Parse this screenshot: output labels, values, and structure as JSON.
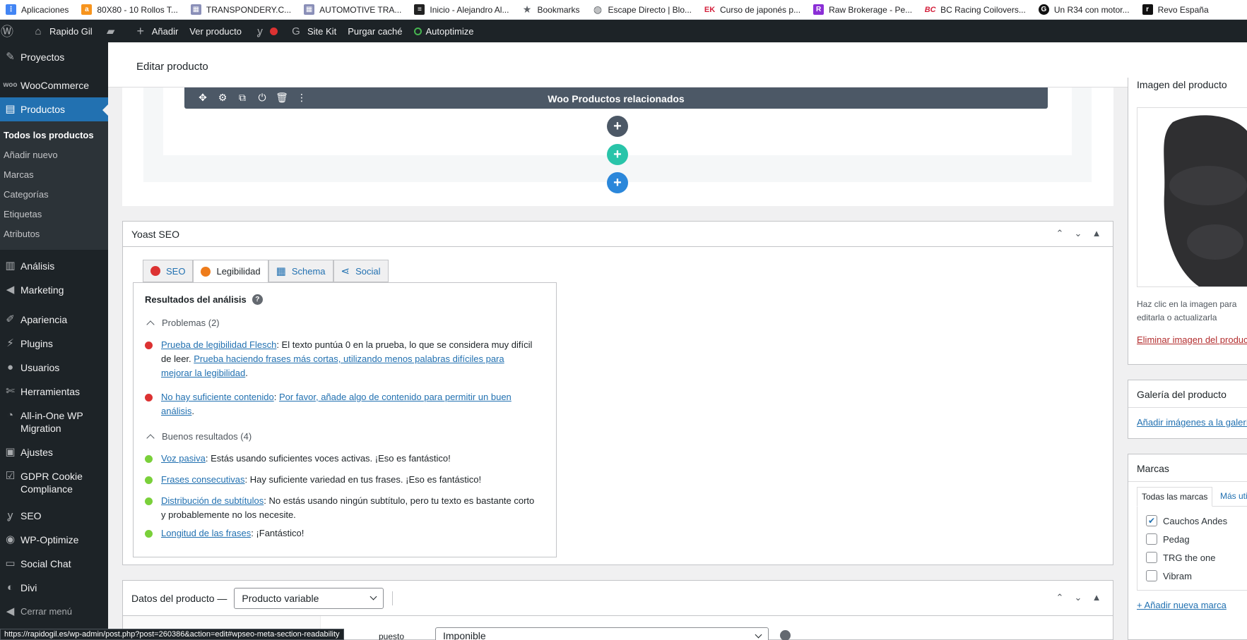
{
  "bookmarks": [
    {
      "label": "Aplicaciones",
      "icon": "apps-grid-icon",
      "color": "#4285f4"
    },
    {
      "label": "80X80 - 10 Rollos T...",
      "icon": "shop-icon",
      "color": "#f7941d"
    },
    {
      "label": "TRANSPONDERY.C...",
      "icon": "grid-icon",
      "color": "#8a8fb8"
    },
    {
      "label": "AUTOMOTIVE TRA...",
      "icon": "grid-icon",
      "color": "#8a8fb8"
    },
    {
      "label": "Inicio - Alejandro Al...",
      "icon": "stripes-icon",
      "color": "#222222"
    },
    {
      "label": "Bookmarks",
      "icon": "star-icon",
      "color": "#5f6368"
    },
    {
      "label": "Escape Directo | Blo...",
      "icon": "globe-icon",
      "color": "#5f6368"
    },
    {
      "label": "Curso de japonés p...",
      "icon": "ek-icon",
      "color": "#d4213d"
    },
    {
      "label": "Raw Brokerage - Pe...",
      "icon": "raw-icon",
      "color": "#8b2fd6"
    },
    {
      "label": "BC Racing Coilovers...",
      "icon": "bc-icon",
      "color": "#d4213d"
    },
    {
      "label": "Un R34 con motor...",
      "icon": "g-icon",
      "color": "#111111"
    },
    {
      "label": "Revo España",
      "icon": "revo-icon",
      "color": "#111111"
    }
  ],
  "adminbar": {
    "site": "Rapido Gil",
    "add": "Añadir",
    "view": "Ver producto",
    "sitekit": "Site Kit",
    "purge": "Purgar caché",
    "autoptimize": "Autoptimize"
  },
  "sidebar": {
    "items_top": [
      "Proyectos",
      "WooCommerce",
      "Productos"
    ],
    "submenu": [
      "Todos los productos",
      "Añadir nuevo",
      "Marcas",
      "Categorías",
      "Etiquetas",
      "Atributos"
    ],
    "items_bottom": [
      "Análisis",
      "Marketing",
      "Apariencia",
      "Plugins",
      "Usuarios",
      "Herramientas",
      "All-in-One WP Migration",
      "Ajustes",
      "GDPR Cookie Compliance",
      "SEO",
      "WP-Optimize",
      "Social Chat",
      "Divi",
      "Cerrar menú"
    ]
  },
  "header": {
    "title": "Editar producto"
  },
  "divi": {
    "module_title": "Woo Productos relacionados"
  },
  "yoast": {
    "title": "Yoast SEO",
    "tabs": [
      "SEO",
      "Legibilidad",
      "Schema",
      "Social"
    ],
    "analysis_title": "Resultados del análisis",
    "problems_head": "Problemas (2)",
    "problems": [
      {
        "link": "Prueba de legibilidad Flesch",
        "text": ": El texto puntúa 0 en la prueba, lo que se considera muy difícil de leer. ",
        "link2": "Prueba haciendo frases más cortas, utilizando menos palabras difíciles para mejorar la legibilidad",
        "end": "."
      },
      {
        "link": "No hay suficiente contenido",
        "text": ": ",
        "link2": "Por favor, añade algo de contenido para permitir un buen análisis",
        "end": "."
      }
    ],
    "good_head": "Buenos resultados (4)",
    "good": [
      {
        "link": "Voz pasiva",
        "text": ": Estás usando suficientes voces activas. ¡Eso es fantástico!"
      },
      {
        "link": "Frases consecutivas",
        "text": ": Hay suficiente variedad en tus frases. ¡Eso es fantástico!"
      },
      {
        "link": "Distribución de subtítulos",
        "text": ": No estás usando ningún subtítulo, pero tu texto es bastante corto y probablemente no los necesite."
      },
      {
        "link": "Longitud de las frases",
        "text": ": ¡Fantástico!"
      }
    ]
  },
  "product_data": {
    "label": "Datos del producto —",
    "type": "Producto variable",
    "tax_label": "puesto",
    "tax_value": "Imponible"
  },
  "right": {
    "image_title": "Imagen del producto",
    "image_hint": "Haz clic en la imagen para editarla o actualizarla",
    "remove_image": "Eliminar imagen del producto",
    "gallery_title": "Galería del producto",
    "gallery_link": "Añadir imágenes a la galería",
    "brands_title": "Marcas",
    "brand_tabs": [
      "Todas las marcas",
      "Más utilizadas"
    ],
    "brands": [
      {
        "name": "Cauchos Andes",
        "checked": true
      },
      {
        "name": "Pedag",
        "checked": false
      },
      {
        "name": "TRG the one",
        "checked": false
      },
      {
        "name": "Vibram",
        "checked": false
      }
    ],
    "add_brand": "+ Añadir nueva marca"
  },
  "status_url": "https://rapidogil.es/wp-admin/post.php?post=260386&action=edit#wpseo-meta-section-readability",
  "colors": {
    "accent": "#2271b1",
    "adminbar": "#1d2327",
    "red": "#dc3232",
    "green": "#7ad03a",
    "orange": "#ee7c1b",
    "teal": "#29c4a9",
    "blue": "#2b87da"
  }
}
